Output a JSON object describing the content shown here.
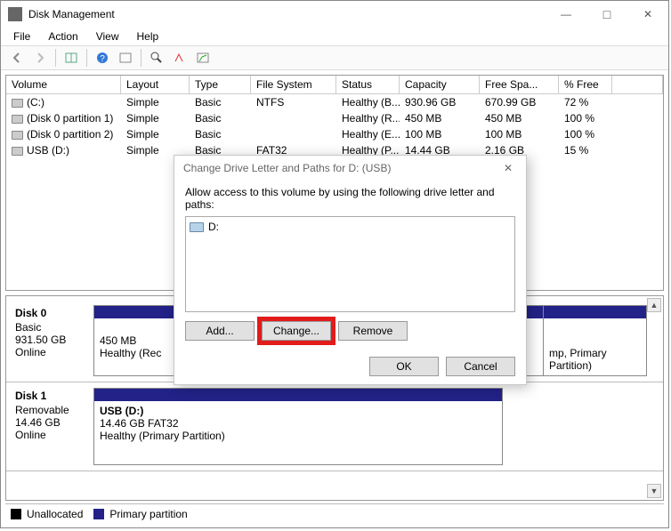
{
  "window": {
    "title": "Disk Management"
  },
  "menu": {
    "file": "File",
    "action": "Action",
    "view": "View",
    "help": "Help"
  },
  "table": {
    "headers": [
      "Volume",
      "Layout",
      "Type",
      "File System",
      "Status",
      "Capacity",
      "Free Spa...",
      "% Free"
    ],
    "rows": [
      {
        "volume": "(C:)",
        "layout": "Simple",
        "type": "Basic",
        "fs": "NTFS",
        "status": "Healthy (B...",
        "capacity": "930.96 GB",
        "free": "670.99 GB",
        "pct": "72 %"
      },
      {
        "volume": "(Disk 0 partition 1)",
        "layout": "Simple",
        "type": "Basic",
        "fs": "",
        "status": "Healthy (R...",
        "capacity": "450 MB",
        "free": "450 MB",
        "pct": "100 %"
      },
      {
        "volume": "(Disk 0 partition 2)",
        "layout": "Simple",
        "type": "Basic",
        "fs": "",
        "status": "Healthy (E...",
        "capacity": "100 MB",
        "free": "100 MB",
        "pct": "100 %"
      },
      {
        "volume": "USB (D:)",
        "layout": "Simple",
        "type": "Basic",
        "fs": "FAT32",
        "status": "Healthy (P...",
        "capacity": "14.44 GB",
        "free": "2.16 GB",
        "pct": "15 %"
      }
    ]
  },
  "disks": {
    "disk0": {
      "name": "Disk 0",
      "kind": "Basic",
      "size": "931.50 GB",
      "status": "Online",
      "part1": {
        "line1": "",
        "line2": "450 MB",
        "line3": "Healthy (Rec"
      },
      "part2_tail": "mp, Primary Partition)"
    },
    "disk1": {
      "name": "Disk 1",
      "kind": "Removable",
      "size": "14.46 GB",
      "status": "Online",
      "part": {
        "line1": "USB  (D:)",
        "line2": "14.46 GB FAT32",
        "line3": "Healthy (Primary Partition)"
      }
    }
  },
  "legend": {
    "unallocated": "Unallocated",
    "primary": "Primary partition"
  },
  "dialog": {
    "title": "Change Drive Letter and Paths for D: (USB)",
    "instruction": "Allow access to this volume by using the following drive letter and paths:",
    "entry": "D:",
    "btn_add": "Add...",
    "btn_change": "Change...",
    "btn_remove": "Remove",
    "btn_ok": "OK",
    "btn_cancel": "Cancel"
  }
}
